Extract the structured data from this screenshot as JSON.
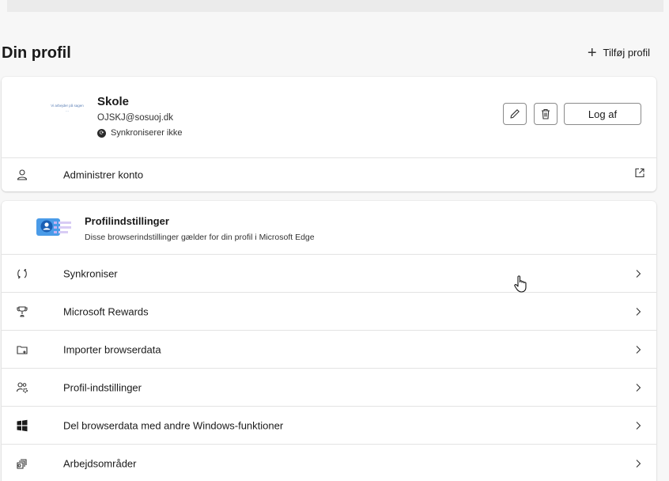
{
  "header": {
    "title": "Din profil",
    "add_profile_label": "Tilføj profil"
  },
  "profile": {
    "picture_text": "Vi arbejder på sagen ...",
    "name": "Skole",
    "email": "OJSKJ@sosuoj.dk",
    "sync_status": "Synkroniserer ikke",
    "logout_label": "Log af",
    "manage_label": "Administrer konto"
  },
  "settings": {
    "title": "Profilindstillinger",
    "description": "Disse browserindstillinger gælder for din profil i Microsoft Edge",
    "items": [
      {
        "label": "Synkroniser",
        "icon": "sync-icon"
      },
      {
        "label": "Microsoft Rewards",
        "icon": "rewards-trophy-icon"
      },
      {
        "label": "Importer browserdata",
        "icon": "import-icon"
      },
      {
        "label": "Profil-indstillinger",
        "icon": "profile-settings-icon"
      },
      {
        "label": "Del browserdata med andre Windows-funktioner",
        "icon": "windows-icon"
      },
      {
        "label": "Arbejdsområder",
        "icon": "workspaces-icon"
      }
    ]
  },
  "colors": {
    "page_bg": "#f7f7f7",
    "card_bg": "#ffffff",
    "border": "#8a8a8a",
    "divider": "#e3e3e3"
  }
}
